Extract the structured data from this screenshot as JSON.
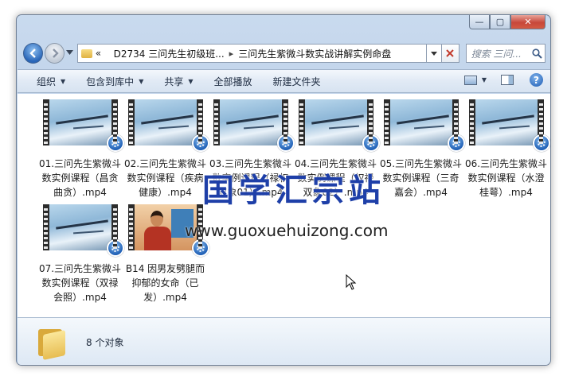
{
  "window": {
    "caption": {
      "minimize": "—",
      "maximize": "▢",
      "close": "✕"
    }
  },
  "address_bar": {
    "overflow": "«",
    "crumbs": [
      "D2734 三问先生初级班...",
      "三问先生紫微斗数实战讲解实例命盘"
    ],
    "search_placeholder": "搜索 三问..."
  },
  "toolbar": {
    "organize": "组织",
    "include_in_library": "包含到库中",
    "share": "共享",
    "play_all": "全部播放",
    "new_folder": "新建文件夹"
  },
  "files": [
    {
      "name": "01.三问先生紫微斗数实例课程（昌贪曲贪）.mp4",
      "thumb": "landscape"
    },
    {
      "name": "02.三问先生紫微斗数实例课程（疾病健康）.mp4",
      "thumb": "landscape"
    },
    {
      "name": "03.三问先生紫微斗数实例课程（禄权双象01）.mp4",
      "thumb": "landscape"
    },
    {
      "name": "04.三问先生紫微斗数实例课程（权禄双象02）.mp4",
      "thumb": "landscape"
    },
    {
      "name": "05.三问先生紫微斗数实例课程（三奇嘉会）.mp4",
      "thumb": "landscape"
    },
    {
      "name": "06.三问先生紫微斗数实例课程（水澄桂萼）.mp4",
      "thumb": "landscape"
    },
    {
      "name": "07.三问先生紫微斗数实例课程（双禄会照）.mp4",
      "thumb": "landscape"
    },
    {
      "name": "B14 因男友劈腿而抑郁的女命（已发）.mp4",
      "thumb": "person"
    }
  ],
  "watermark": {
    "text": "国学汇宗站",
    "url": "www.guoxuehuizong.com"
  },
  "details": {
    "count": "8 个对象"
  },
  "colors": {
    "frame": "#b5cbe6",
    "watermark": "#1e3fa8",
    "close_button": "#c7473a"
  }
}
